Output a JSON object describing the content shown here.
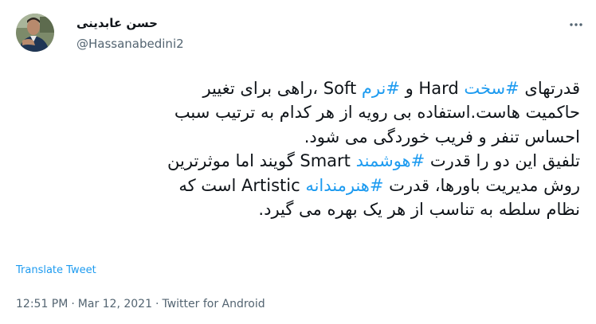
{
  "author": {
    "name": "حسن عابدینی",
    "handle": "@Hassanabedini2"
  },
  "tweet": {
    "lines": [
      [
        {
          "t": "قدرتهای ",
          "h": false
        },
        {
          "t": "#سخت",
          "h": true
        },
        {
          "t": " Hard و ",
          "h": false
        },
        {
          "t": "#نرم",
          "h": true
        },
        {
          "t": " Soft ،راهی برای تغییر",
          "h": false
        }
      ],
      [
        {
          "t": "حاکمیت هاست.استفاده بی رویه از هر کدام به ترتیب سبب",
          "h": false
        }
      ],
      [
        {
          "t": "احساس تنفر و فریب خوردگی می شود.",
          "h": false
        }
      ],
      [
        {
          "t": "تلفیق این دو را قدرت ",
          "h": false
        },
        {
          "t": "#هوشمند",
          "h": true
        },
        {
          "t": " Smart گویند اما موثرترین",
          "h": false
        }
      ],
      [
        {
          "t": "روش مدیریت باورها، قدرت ",
          "h": false
        },
        {
          "t": "#هنرمندانه",
          "h": true
        },
        {
          "t": " Artistic است که",
          "h": false
        }
      ],
      [
        {
          "t": "نظام سلطه به تناسب از هر یک بهره می گیرد.",
          "h": false
        }
      ]
    ]
  },
  "translate_label": "Translate Tweet",
  "meta": {
    "time": "12:51 PM",
    "date": "Mar 12, 2021",
    "source": "Twitter for Android",
    "separator": "·"
  },
  "icons": {
    "more": "more-horizontal-icon",
    "avatar": "profile-photo"
  },
  "colors": {
    "hashtag": "#1d9bf0",
    "secondary_text": "#536471",
    "primary_text": "#0f1419"
  }
}
